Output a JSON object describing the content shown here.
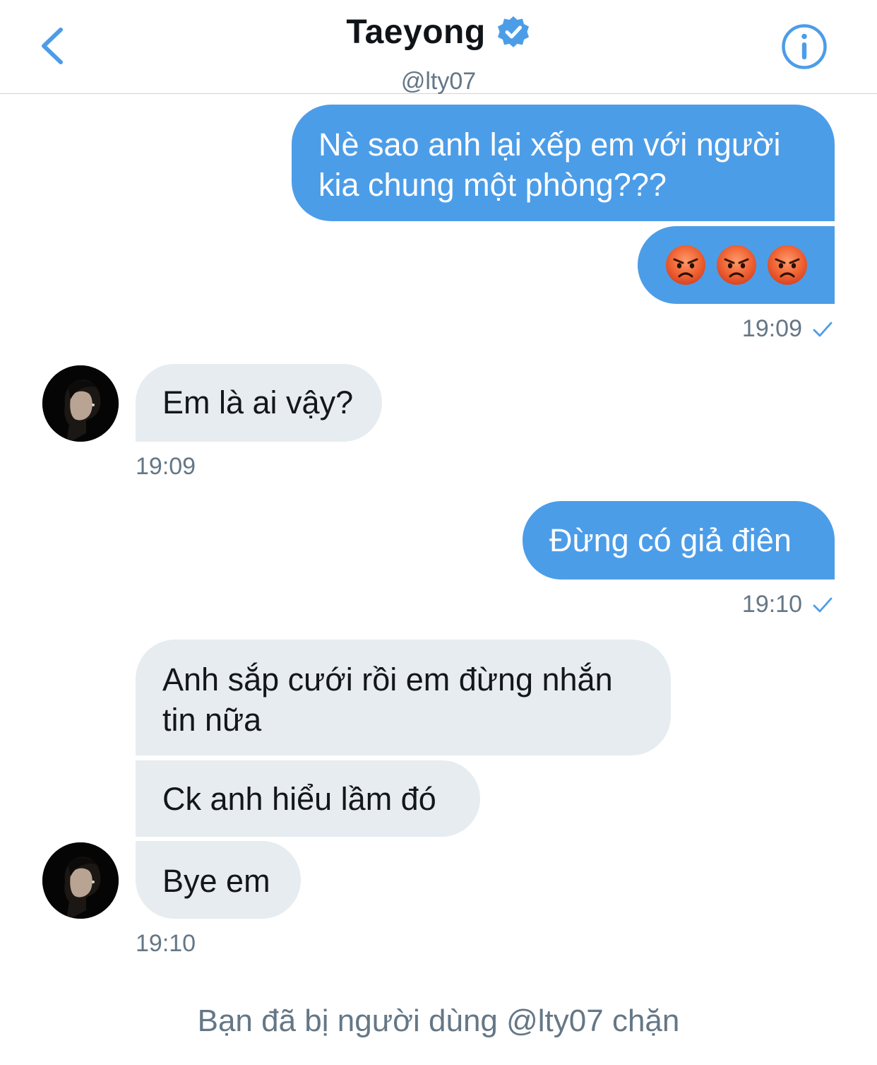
{
  "header": {
    "name": "Taeyong",
    "handle": "@lty07",
    "verified_color": "#4c9de8",
    "accent_color": "#4c9de8"
  },
  "messages": [
    {
      "dir": "out",
      "text": "Nè sao anh lại xếp em với người kia chung một phòng???"
    },
    {
      "dir": "out",
      "emoji": [
        "angry-face",
        "angry-face",
        "angry-face"
      ]
    },
    {
      "dir": "out",
      "time": "19:09",
      "read": true
    },
    {
      "dir": "in",
      "text": "Em là ai vậy?"
    },
    {
      "dir": "in",
      "time": "19:09"
    },
    {
      "dir": "out",
      "text": "Đừng có giả điên"
    },
    {
      "dir": "out",
      "time": "19:10",
      "read": true
    },
    {
      "dir": "in",
      "text": "Anh sắp cưới rồi em đừng nhắn tin nữa"
    },
    {
      "dir": "in",
      "text": "Ck anh hiểu lầm đó"
    },
    {
      "dir": "in",
      "text": "Bye em"
    },
    {
      "dir": "in",
      "time": "19:10"
    }
  ],
  "footer": {
    "blocked_notice": "Bạn đã bị người dùng @lty07 chặn"
  },
  "colors": {
    "outgoing_bubble": "#4c9de8",
    "incoming_bubble": "#e6ecf0",
    "secondary_text": "#657786"
  }
}
